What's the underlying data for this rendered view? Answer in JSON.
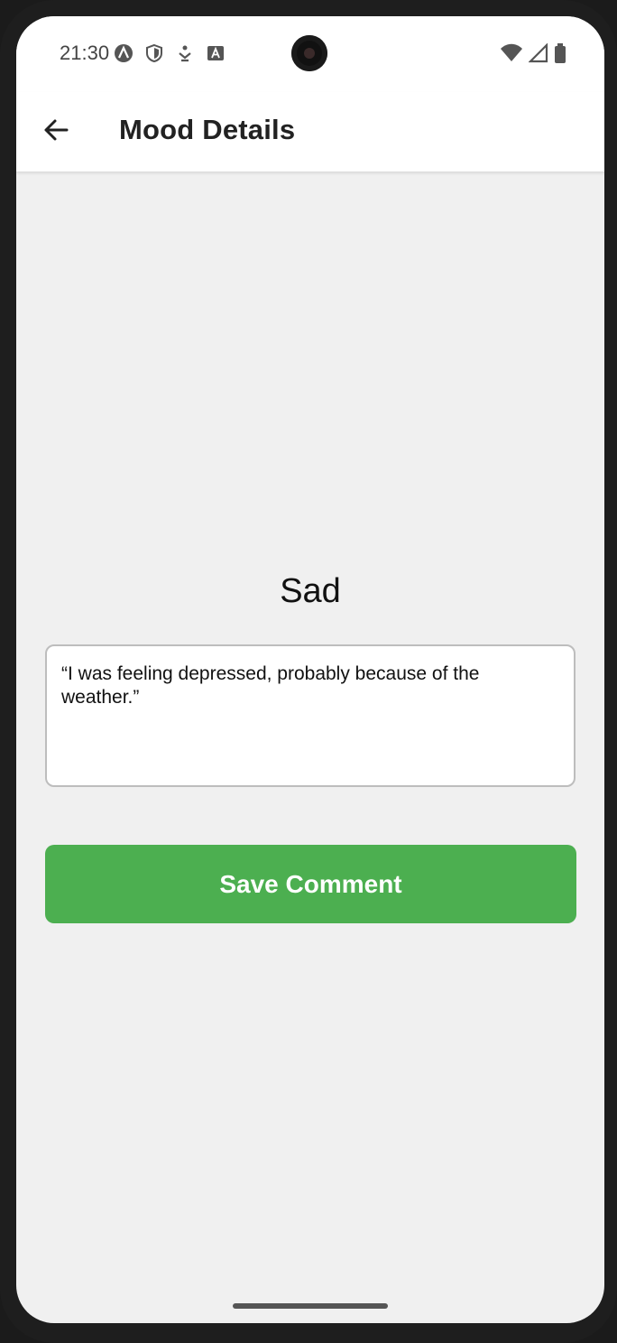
{
  "status_bar": {
    "time": "21:30",
    "left_icons": [
      "app-a-icon",
      "shield-icon",
      "download-icon",
      "font-a-icon"
    ],
    "right_icons": [
      "wifi-icon",
      "signal-icon",
      "battery-icon"
    ]
  },
  "app_bar": {
    "title": "Mood Details",
    "back_icon": "arrow-left-icon"
  },
  "main": {
    "mood": "Sad",
    "comment_value": "“I was feeling depressed, probably because of the weather.”",
    "save_label": "Save Comment"
  },
  "colors": {
    "accent": "#4caf50",
    "background": "#f0f0f0",
    "surface": "#ffffff"
  }
}
